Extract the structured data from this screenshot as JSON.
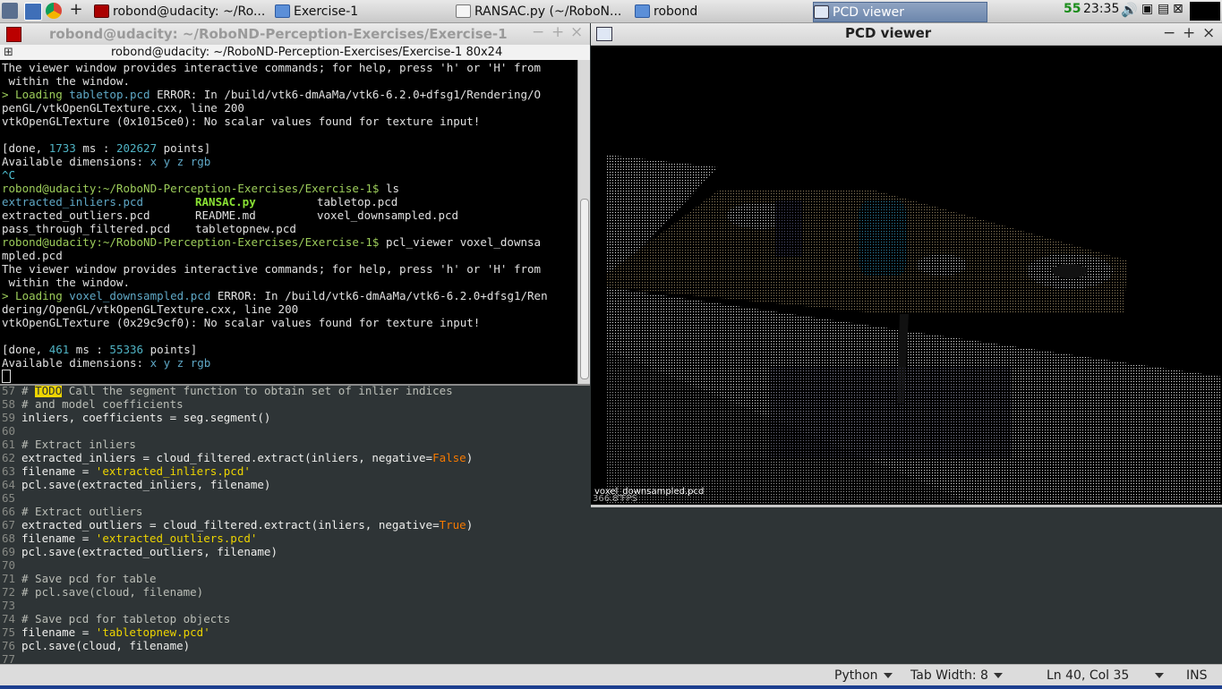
{
  "taskbar": {
    "tasks": [
      {
        "label": "robond@udacity: ~/Ro...",
        "icon": "terminal-icon"
      },
      {
        "label": "Exercise-1",
        "icon": "folder-icon"
      },
      {
        "label": "RANSAC.py (~/RoboN...",
        "icon": "text-editor-icon"
      },
      {
        "label": "robond",
        "icon": "folder-icon"
      },
      {
        "label": "PCD viewer",
        "icon": "window-icon"
      }
    ],
    "tray": {
      "battery_count": "55",
      "clock": "23:35"
    }
  },
  "terminal": {
    "title": "robond@udacity: ~/RoboND-Perception-Exercises/Exercise-1",
    "subtitle": "robond@udacity: ~/RoboND-Perception-Exercises/Exercise-1 80x24",
    "lines": [
      "The viewer window provides interactive commands; for help, press 'h' or 'H' from",
      " within the window.",
      "> Loading ",
      "tabletop.pcd",
      " ERROR: In /build/vtk6-dmAaMa/vtk6-6.2.0+dfsg1/Rendering/O",
      "penGL/vtkOpenGLTexture.cxx, line 200",
      "vtkOpenGLTexture (0x1015ce0): No scalar values found for texture input!",
      "[done, ",
      "1733",
      " ms : ",
      "202627",
      " points]",
      "Available dimensions: ",
      "x y z rgb",
      "^C",
      "robond@udacity:~/RoboND-Perception-Exercises/Exercise-1$",
      " ls",
      "extracted_inliers.pcd",
      "RANSAC.py",
      "tabletop.pcd",
      "extracted_outliers.pcd",
      "README.md",
      "voxel_downsampled.pcd",
      "pass_through_filtered.pcd",
      "tabletopnew.pcd",
      " pcl_viewer voxel_downsa",
      "mpled.pcd",
      "voxel_downsampled.pcd",
      " ERROR: In /build/vtk6-dmAaMa/vtk6-6.2.0+dfsg1/Ren",
      "dering/OpenGL/vtkOpenGLTexture.cxx, line 200",
      "vtkOpenGLTexture (0x29c9cf0): No scalar values found for texture input!",
      "461",
      "55336"
    ]
  },
  "editor": {
    "lines": [
      {
        "n": "57",
        "todo": "TODO",
        "text": " Call the segment function to obtain set of inlier indices",
        "pre": "# "
      },
      {
        "n": "58",
        "comment": "# and model coefficients"
      },
      {
        "n": "59",
        "code": "inliers, coefficients = seg.segment()"
      },
      {
        "n": "60"
      },
      {
        "n": "61",
        "comment": "# Extract inliers"
      },
      {
        "n": "62",
        "code": "extracted_inliers = cloud_filtered.extract(inliers, negative=",
        "kw": "False",
        "post": ")"
      },
      {
        "n": "63",
        "code": "filename = ",
        "str": "'extracted_inliers.pcd'"
      },
      {
        "n": "64",
        "code": "pcl.save(extracted_inliers, filename)"
      },
      {
        "n": "65"
      },
      {
        "n": "66",
        "comment": "# Extract outliers"
      },
      {
        "n": "67",
        "code": "extracted_outliers = cloud_filtered.extract(inliers, negative=",
        "kw": "True",
        "post": ")"
      },
      {
        "n": "68",
        "code": "filename = ",
        "str": "'extracted_outliers.pcd'"
      },
      {
        "n": "69",
        "code": "pcl.save(extracted_outliers, filename)"
      },
      {
        "n": "70"
      },
      {
        "n": "71",
        "comment": "# Save pcd for table"
      },
      {
        "n": "72",
        "comment": "# pcl.save(cloud, filename)"
      },
      {
        "n": "73"
      },
      {
        "n": "74",
        "comment": "# Save pcd for tabletop objects"
      },
      {
        "n": "75",
        "code": "filename = ",
        "str": "'tabletopnew.pcd'"
      },
      {
        "n": "76",
        "code": "pcl.save(cloud, filename)"
      },
      {
        "n": "77"
      }
    ]
  },
  "pcd_viewer": {
    "title": "PCD viewer",
    "filename_label": "voxel_downsampled.pcd",
    "fps_label": "366.8 FPS"
  },
  "statusbar": {
    "language": "Python",
    "tab_width": "Tab Width: 8",
    "position": "Ln 40, Col 35",
    "mode": "INS"
  },
  "colors": {
    "terminal_bg": "#000000",
    "editor_bg": "#2e3436",
    "comment": "#babdb6",
    "string": "#edd400",
    "keyword": "#f57900",
    "prompt": "#9ccc5a",
    "file": "#5fa8c6"
  }
}
